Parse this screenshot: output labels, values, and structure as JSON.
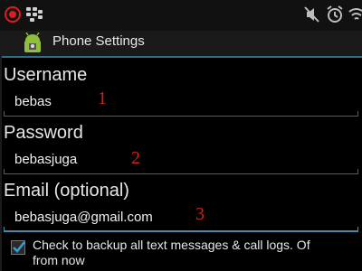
{
  "status_bar": {
    "icons": [
      "record-icon",
      "blackberry-messenger-icon",
      "mute-icon",
      "alarm-icon",
      "wifi-icon"
    ]
  },
  "app": {
    "title": "Phone Settings",
    "icon": "android-app-icon"
  },
  "form": {
    "username": {
      "label": "Username",
      "value": "bebas",
      "marker": "1"
    },
    "password": {
      "label": "Password",
      "value": "bebasjuga",
      "marker": "2"
    },
    "email": {
      "label": "Email (optional)",
      "value": "bebasjuga@gmail.com",
      "marker": "3"
    },
    "backup_checkbox": {
      "checked": true,
      "label_line1": "Check to backup all text messages & call logs. Of",
      "label_line2": "from now"
    }
  },
  "colors": {
    "accent": "#3a8fb0",
    "marker": "#d81e1e",
    "background": "#000000"
  }
}
